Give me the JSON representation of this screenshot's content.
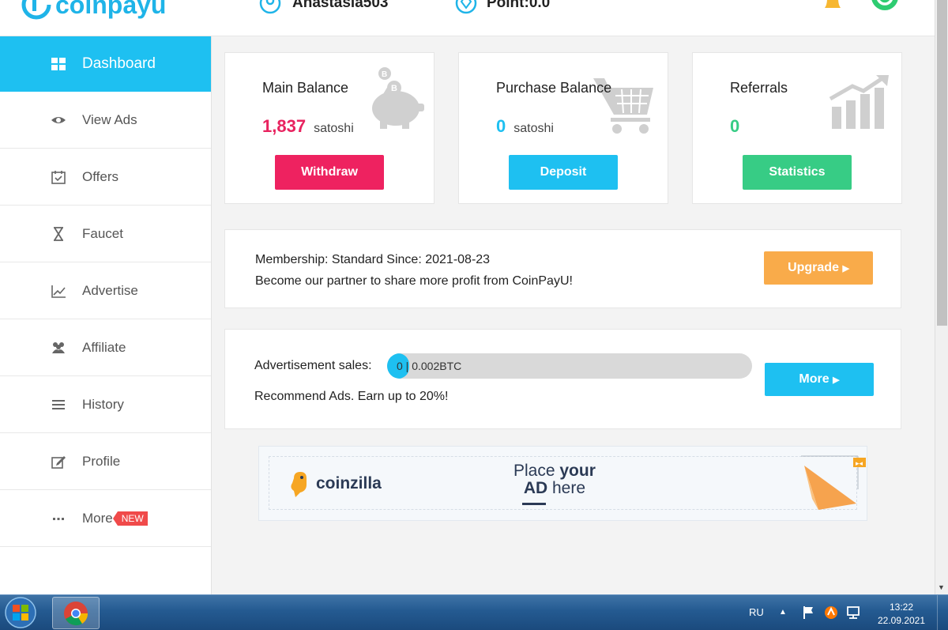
{
  "header": {
    "logo_text": "coinpayu",
    "username": "Anastasia503",
    "point": "Point:0.0"
  },
  "sidebar": {
    "items": [
      {
        "label": "Dashboard"
      },
      {
        "label": "View Ads"
      },
      {
        "label": "Offers"
      },
      {
        "label": "Faucet"
      },
      {
        "label": "Advertise"
      },
      {
        "label": "Affiliate"
      },
      {
        "label": "History"
      },
      {
        "label": "Profile"
      },
      {
        "label": "More",
        "badge": "NEW"
      }
    ]
  },
  "balances": {
    "main": {
      "title": "Main Balance",
      "amount": "1,837",
      "unit": "satoshi",
      "button": "Withdraw",
      "icon": "piggy-bank-icon"
    },
    "purchase": {
      "title": "Purchase Balance",
      "amount": "0",
      "unit": "satoshi",
      "button": "Deposit",
      "icon": "cart-icon"
    },
    "referrals": {
      "title": "Referrals",
      "amount": "0",
      "button": "Statistics",
      "icon": "growth-chart-icon"
    }
  },
  "membership": {
    "line1": "Membership: Standard Since: 2021-08-23",
    "line2": "Become our partner to share more profit from CoinPayU!",
    "button": "Upgrade"
  },
  "ads_sales": {
    "label": "Advertisement sales:",
    "progress_text": "0 | 0.002BTC",
    "progress_fraction": 0.05,
    "sub": "Recommend Ads. Earn up to 20%!",
    "button": "More"
  },
  "banner": {
    "brand": "coinzilla",
    "line1_a": "Place ",
    "line1_b": "your",
    "line2_a": "AD",
    "line2_b": " here"
  },
  "taskbar": {
    "lang": "RU",
    "time": "13:22",
    "date": "22.09.2021"
  },
  "colors": {
    "accent": "#1ec0f1",
    "withdraw": "#ee2260",
    "statistics": "#37cc85",
    "upgrade": "#f9ab4a",
    "main_amount": "#e8235f",
    "purchase_amount": "#1ec0f1",
    "referrals_amount": "#37cc85"
  }
}
